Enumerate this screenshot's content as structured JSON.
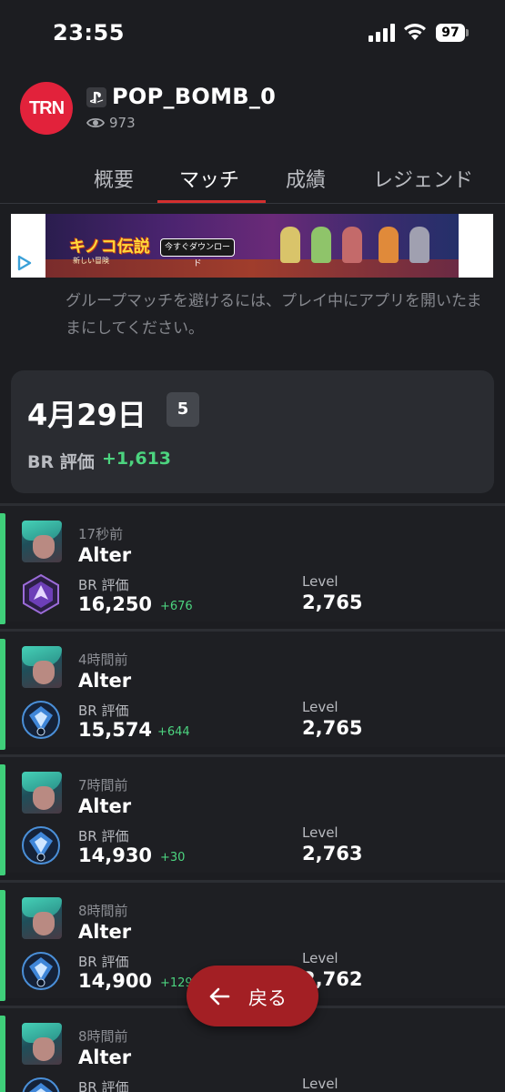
{
  "status_bar": {
    "time": "23:55",
    "battery": "97",
    "icons": [
      "signal-icon",
      "wifi-icon",
      "battery-icon"
    ]
  },
  "header": {
    "logo_text": "TRN",
    "platform_icon": "playstation-icon",
    "player_name": "POP_BOMB_0",
    "views": "973",
    "brand_color": "#e2223b"
  },
  "tabs": [
    {
      "label": "概要",
      "active": false
    },
    {
      "label": "マッチ",
      "active": true
    },
    {
      "label": "成績",
      "active": false
    },
    {
      "label": "レジェンド",
      "active": false
    }
  ],
  "ad": {
    "title": "キノコ伝説",
    "subtitle": "新しい冒険",
    "cta": "今すぐダウンロード"
  },
  "notice": "グループマッチを避けるには、プレイ中にアプリを開いたままにしてください。",
  "date_group": {
    "date": "4月29日",
    "match_count": "5",
    "rating_label": "BR 評価",
    "rating_delta": "+1,613"
  },
  "matches": [
    {
      "time_ago": "17秒前",
      "legend": "Alter",
      "rating_label": "BR 評価",
      "rating": "16,250",
      "delta": "+676",
      "level_label": "Level",
      "level": "2,765",
      "rank_icon": "master-rank-icon",
      "result_color": "#3fcf7a"
    },
    {
      "time_ago": "4時間前",
      "legend": "Alter",
      "rating_label": "BR 評価",
      "rating": "15,574",
      "delta": "+644",
      "level_label": "Level",
      "level": "2,765",
      "rank_icon": "diamond-rank-icon",
      "result_color": "#3fcf7a"
    },
    {
      "time_ago": "7時間前",
      "legend": "Alter",
      "rating_label": "BR 評価",
      "rating": "14,930",
      "delta": "+30",
      "level_label": "Level",
      "level": "2,763",
      "rank_icon": "diamond-rank-icon",
      "result_color": "#3fcf7a"
    },
    {
      "time_ago": "8時間前",
      "legend": "Alter",
      "rating_label": "BR 評価",
      "rating": "14,900",
      "delta": "+129",
      "level_label": "Level",
      "level": "2,762",
      "rank_icon": "diamond-rank-icon",
      "result_color": "#3fcf7a"
    },
    {
      "time_ago": "8時間前",
      "legend": "Alter",
      "rating_label": "BR 評価",
      "rating": "",
      "delta": "",
      "level_label": "Level",
      "level": "",
      "rank_icon": "diamond-rank-icon",
      "result_color": "#3fcf7a"
    }
  ],
  "back_button": {
    "label": "戻る",
    "icon": "arrow-left-icon",
    "color": "#a31f24"
  }
}
